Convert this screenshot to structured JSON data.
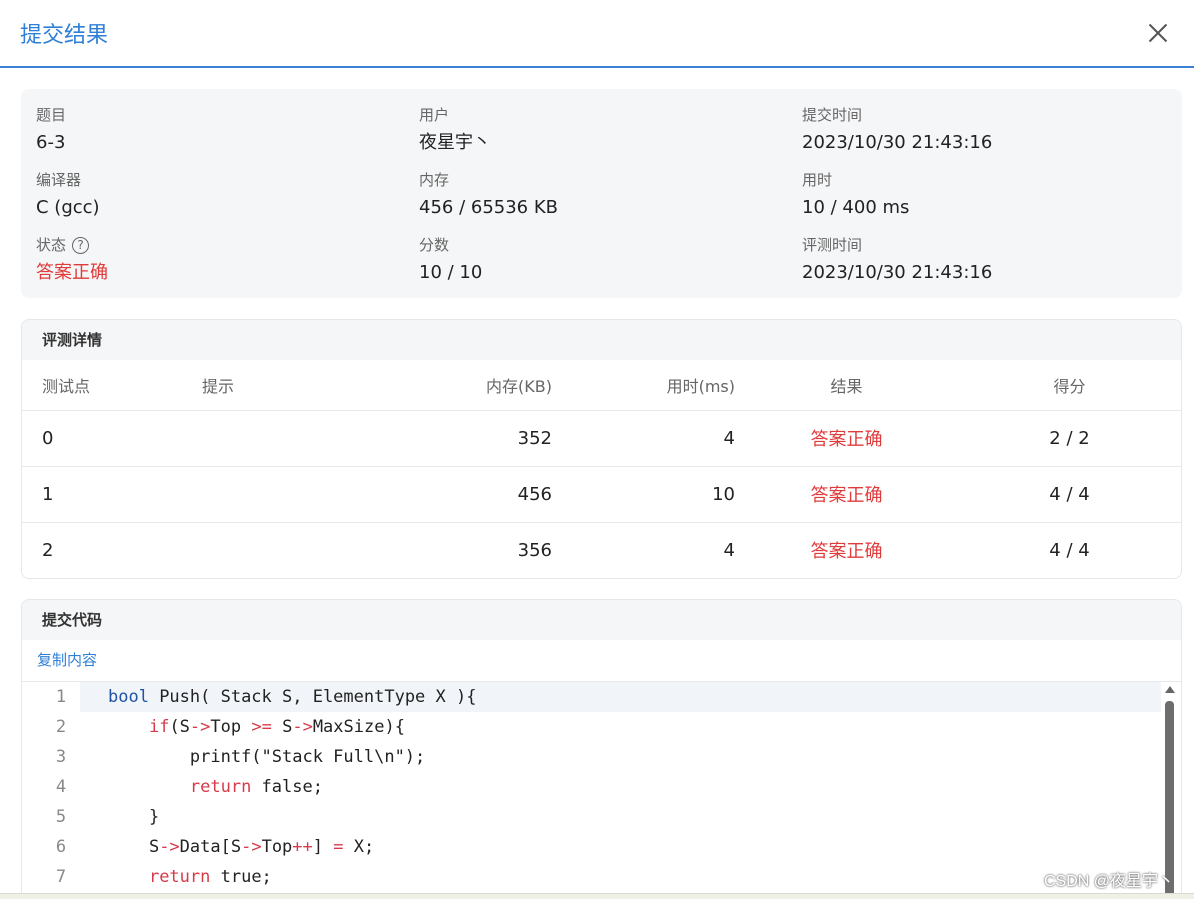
{
  "dialog": {
    "title": "提交结果"
  },
  "info": {
    "problem_label": "题目",
    "problem_value": "6-3",
    "user_label": "用户",
    "user_value": "夜星宇丶",
    "submit_time_label": "提交时间",
    "submit_time_value": "2023/10/30 21:43:16",
    "compiler_label": "编译器",
    "compiler_value": "C (gcc)",
    "memory_label": "内存",
    "memory_value": "456 / 65536 KB",
    "time_label": "用时",
    "time_value": "10 / 400 ms",
    "status_label": "状态",
    "status_help": "?",
    "status_value": "答案正确",
    "score_label": "分数",
    "score_value": "10 / 10",
    "judge_time_label": "评测时间",
    "judge_time_value": "2023/10/30 21:43:16"
  },
  "judge": {
    "title": "评测详情",
    "headers": [
      "测试点",
      "提示",
      "内存(KB)",
      "用时(ms)",
      "结果",
      "得分"
    ],
    "rows": [
      [
        "0",
        "",
        "352",
        "4",
        "答案正确",
        "2 / 2"
      ],
      [
        "1",
        "",
        "456",
        "10",
        "答案正确",
        "4 / 4"
      ],
      [
        "2",
        "",
        "356",
        "4",
        "答案正确",
        "4 / 4"
      ]
    ]
  },
  "code": {
    "title": "提交代码",
    "copy_label": "复制内容",
    "line_numbers": [
      "1",
      "2",
      "3",
      "4",
      "5",
      "6",
      "7"
    ],
    "lines": [
      "bool Push( Stack S, ElementType X ){",
      "    if(S->Top >= S->MaxSize){",
      "        printf(\"Stack Full\\n\");",
      "        return false;",
      "    }",
      "    S->Data[S->Top++] = X;",
      "    return true;"
    ]
  },
  "watermark": "CSDN @夜星宇丶",
  "colors": {
    "accent": "#2f7fd8",
    "success": "#e03a3a"
  }
}
